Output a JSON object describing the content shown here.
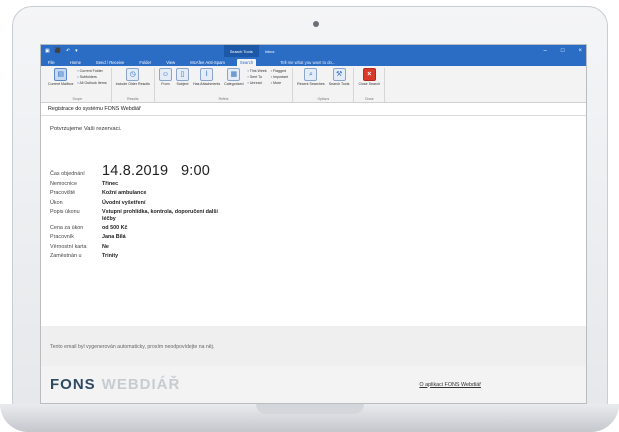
{
  "window": {
    "context_tab": "Search Tools",
    "folder": "Inbox",
    "controls": [
      "–",
      "□",
      "×"
    ]
  },
  "tabs": [
    {
      "label": "File"
    },
    {
      "label": "Home"
    },
    {
      "label": "Send / Receive"
    },
    {
      "label": "Folder"
    },
    {
      "label": "View"
    },
    {
      "label": "McAfee Anti-Spam"
    },
    {
      "label": "Search"
    }
  ],
  "tell_me": "Tell me what you want to do...",
  "ribbon": {
    "scope": {
      "current_mailbox": "Current Mailbox",
      "current_folder": "Current Folder",
      "subfolders": "Subfolders",
      "all_outlook_items": "All Outlook Items",
      "group": "Scope"
    },
    "results": {
      "include_older": "Include Older Results",
      "group": "Results"
    },
    "refine": {
      "from": "From",
      "subject": "Subject",
      "has_attachments": "Has Attachments",
      "categorized": "Categorized",
      "this_week": "This Week",
      "sent_to": "Sent To",
      "unread": "Unread",
      "flagged": "Flagged",
      "important": "Important",
      "more": "More",
      "group": "Refine"
    },
    "options": {
      "recent_searches": "Recent Searches",
      "search_tools": "Search Tools",
      "group": "Options"
    },
    "close": {
      "label": "Close Search",
      "group": "Close"
    }
  },
  "mail": {
    "subject": "Registrace do systému FONS Webdiář",
    "greeting": "Potvrzujeme Vaši rezervaci.",
    "details": [
      {
        "label": "Čas objednání",
        "value": "14.8.2019   9:00"
      },
      {
        "label": "Nemocnice",
        "value": "Třinec"
      },
      {
        "label": "Pracoviště",
        "value": "Kožní ambulance"
      },
      {
        "label": "Úkon",
        "value": "Úvodní vyšetření"
      },
      {
        "label": "Popis úkonu",
        "value": "Vstupní prohlídka, kontrola, doporučení další léčby"
      },
      {
        "label": "Cena za úkon",
        "value": "od 500 Kč"
      },
      {
        "label": "Pracovník",
        "value": "Jana Bílá"
      },
      {
        "label": "Věrnostní karta",
        "value": "Ne"
      },
      {
        "label": "Zaměstnán u",
        "value": "Trinity"
      }
    ],
    "footer_note": "Tento email byl vygenerován automaticky, prosím neodpovídejte na něj.",
    "brand_part1": "FONS",
    "brand_part2": "WEBDIÁŘ",
    "about_link": "O aplikaci FONS Webdiář"
  }
}
